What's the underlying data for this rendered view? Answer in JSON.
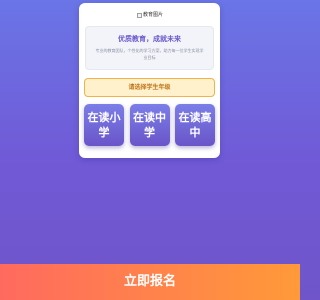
{
  "banner": {
    "alt_text": "教育图片",
    "icon": "broken-image-icon"
  },
  "hero": {
    "title": "优质教育，成就未来",
    "description": "专业的教育团队，个性化的学习方案，助力每一位学生实现学业目标"
  },
  "select_prompt": "请选择学生年级",
  "grades": [
    {
      "label": "在读小学"
    },
    {
      "label": "在读中学"
    },
    {
      "label": "在读高中"
    }
  ],
  "signup": {
    "label": "立即报名"
  },
  "colors": {
    "background_top": "#6a75e6",
    "background_bottom": "#6f55c9",
    "accent": "#6a5acd",
    "prompt_border": "#f2b14a",
    "prompt_text": "#c0761a",
    "signup_start": "#ff6a5f",
    "signup_end": "#ff9a38"
  }
}
